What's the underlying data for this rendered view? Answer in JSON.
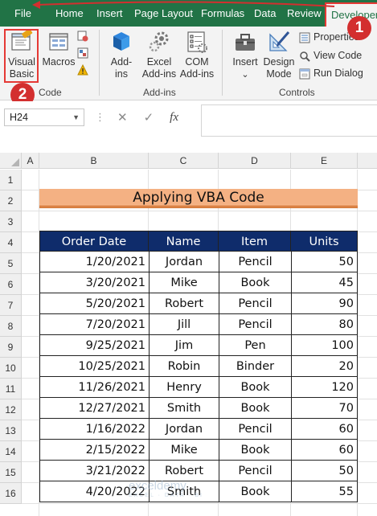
{
  "tabs": [
    "File",
    "Home",
    "Insert",
    "Page Layout",
    "Formulas",
    "Data",
    "Review",
    "Developer"
  ],
  "ribbon": {
    "code_group": {
      "label": "Code",
      "visual_basic": "Visual Basic",
      "visual_basic_line1": "Visual",
      "visual_basic_line2": "Basic",
      "macros": "Macros"
    },
    "addins_group": {
      "label": "Add-ins",
      "addins_line1": "Add-",
      "addins_line2": "ins",
      "excel_addins_line1": "Excel",
      "excel_addins_line2": "Add-ins",
      "com_addins_line1": "COM",
      "com_addins_line2": "Add-ins"
    },
    "controls_group": {
      "label": "Controls",
      "insert": "Insert",
      "insert_arrow": "⌄",
      "design_mode_line1": "Design",
      "design_mode_line2": "Mode",
      "properties": "Properties",
      "view_code": "View Code",
      "run_dialog": "Run Dialog"
    }
  },
  "annotations": {
    "badge1": "1",
    "badge2": "2"
  },
  "formula_bar": {
    "name_box": "H24",
    "cancel": "✕",
    "enter": "✓",
    "fx": "fx",
    "value": ""
  },
  "columns": [
    "A",
    "B",
    "C",
    "D",
    "E"
  ],
  "rows": [
    "1",
    "2",
    "3",
    "4",
    "5",
    "6",
    "7",
    "8",
    "9",
    "10",
    "11",
    "12",
    "13",
    "14",
    "15",
    "16"
  ],
  "sheet": {
    "title": "Applying VBA Code",
    "headers": [
      "Order Date",
      "Name",
      "Item",
      "Units"
    ],
    "data": [
      [
        "1/20/2021",
        "Jordan",
        "Pencil",
        "50"
      ],
      [
        "3/20/2021",
        "Mike",
        "Book",
        "45"
      ],
      [
        "5/20/2021",
        "Robert",
        "Pencil",
        "90"
      ],
      [
        "7/20/2021",
        "Jill",
        "Pencil",
        "80"
      ],
      [
        "9/25/2021",
        "Jim",
        "Pen",
        "100"
      ],
      [
        "10/25/2021",
        "Robin",
        "Binder",
        "20"
      ],
      [
        "11/26/2021",
        "Henry",
        "Book",
        "120"
      ],
      [
        "12/27/2021",
        "Smith",
        "Book",
        "70"
      ],
      [
        "1/16/2022",
        "Jordan",
        "Pencil",
        "60"
      ],
      [
        "2/15/2022",
        "Mike",
        "Book",
        "60"
      ],
      [
        "3/21/2022",
        "Robert",
        "Pencil",
        "50"
      ],
      [
        "4/20/2022",
        "Smith",
        "Book",
        "55"
      ]
    ]
  },
  "watermark": {
    "brand": "exceldemy",
    "tagline": "EXCEL · DATA · BI"
  },
  "colors": {
    "accent": "#217346",
    "header_fill": "#0f2c6b",
    "title_fill": "#f4b183",
    "annotation": "#d32f2f"
  }
}
